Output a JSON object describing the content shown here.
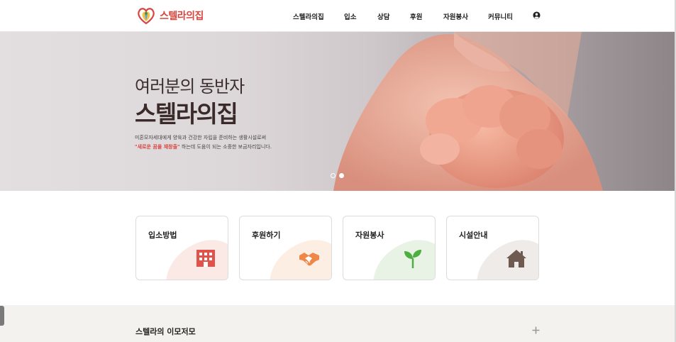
{
  "header": {
    "logo_text": "스텔라의집",
    "nav": [
      "스텔라의집",
      "입소",
      "상담",
      "후원",
      "자원봉사",
      "커뮤니티"
    ],
    "user_icon": "user-circle-icon"
  },
  "hero": {
    "subtitle": "여러분의 동반자",
    "title": "스텔라의집",
    "desc_line1": "미혼모자세대에게 양육과 건강한 자립을 준비하는 생활시설로써",
    "desc_highlight": "\"새로운 꿈을 재창출\"",
    "desc_line2_rest": " 하는데 도움이 되는 소중한 보금자리입니다.",
    "slides": {
      "total": 2,
      "active": 2
    }
  },
  "cards": [
    {
      "label": "입소방법",
      "icon": "building-icon",
      "color": "#e0524a",
      "blob": "#fbe9e6"
    },
    {
      "label": "후원하기",
      "icon": "handshake-icon",
      "color": "#ef8748",
      "blob": "#fdeee4"
    },
    {
      "label": "자원봉사",
      "icon": "sprout-icon",
      "color": "#4caf3f",
      "blob": "#e9f3e5"
    },
    {
      "label": "시설안내",
      "icon": "house-icon",
      "color": "#6e5a50",
      "blob": "#eeebe8"
    }
  ],
  "bottom": {
    "title": "스텔라의 이모저모",
    "expand_icon": "plus-icon"
  },
  "colors": {
    "accent": "#d8453f",
    "bottom_bg": "#f4f2ee"
  }
}
